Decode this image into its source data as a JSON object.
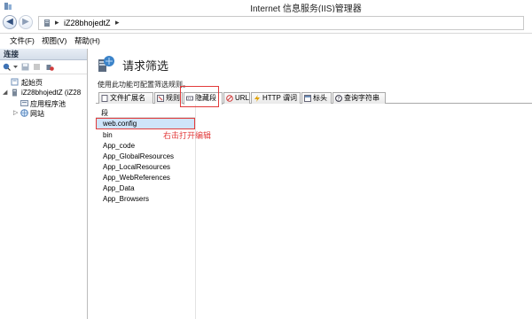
{
  "window": {
    "title": "Internet 信息服务(IIS)管理器"
  },
  "address": {
    "node": "iZ28bhojedtZ",
    "separator": "▸"
  },
  "menu": [
    {
      "label": "文件(F)"
    },
    {
      "label": "视图(V)"
    },
    {
      "label": "帮助(H)"
    }
  ],
  "connections": {
    "header": "连接",
    "tree": [
      {
        "label": "起始页"
      },
      {
        "label": "iZ28bhojedtZ (iZ28"
      },
      {
        "label": "应用程序池"
      },
      {
        "label": "网站"
      }
    ]
  },
  "feature": {
    "title": "请求筛选",
    "description": "使用此功能可配置筛选规则。"
  },
  "tabs": [
    {
      "label": "文件扩展名",
      "icon": "document-icon"
    },
    {
      "label": "规则",
      "icon": "rules-icon"
    },
    {
      "label": "隐藏段",
      "icon": "hidden-segment-icon",
      "active": true
    },
    {
      "label": "URL",
      "icon": "url-icon"
    },
    {
      "label": "HTTP 谓词",
      "icon": "lightning-icon"
    },
    {
      "label": "标头",
      "icon": "header-icon"
    },
    {
      "label": "查询字符串",
      "icon": "help-icon"
    }
  ],
  "grid": {
    "column": "段",
    "rows": [
      {
        "label": "web.config",
        "selected": true
      },
      {
        "label": "bin"
      },
      {
        "label": "App_code"
      },
      {
        "label": "App_GlobalResources"
      },
      {
        "label": "App_LocalResources"
      },
      {
        "label": "App_WebReferences"
      },
      {
        "label": "App_Data"
      },
      {
        "label": "App_Browsers"
      }
    ]
  },
  "annotation": {
    "text": "右击打开编辑",
    "color": "#e23b3b"
  }
}
